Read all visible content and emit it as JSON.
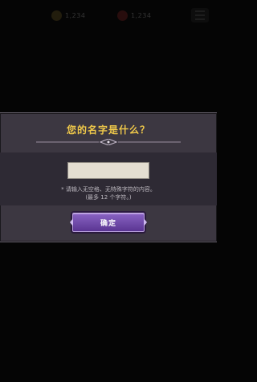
{
  "hud": {
    "stat1_value": "1,234",
    "stat2_value": "1,234"
  },
  "dialog": {
    "title": "您的名字是什么？",
    "input_value": "",
    "hint_line1": "* 请输入无空格、无特殊字符的内容。",
    "hint_line2": "(最多 12 个字符。)",
    "confirm_label": "确定"
  },
  "colors": {
    "title": "#f0c94a",
    "button": "#7a52b8",
    "dialog_bg": "#3c3741"
  }
}
